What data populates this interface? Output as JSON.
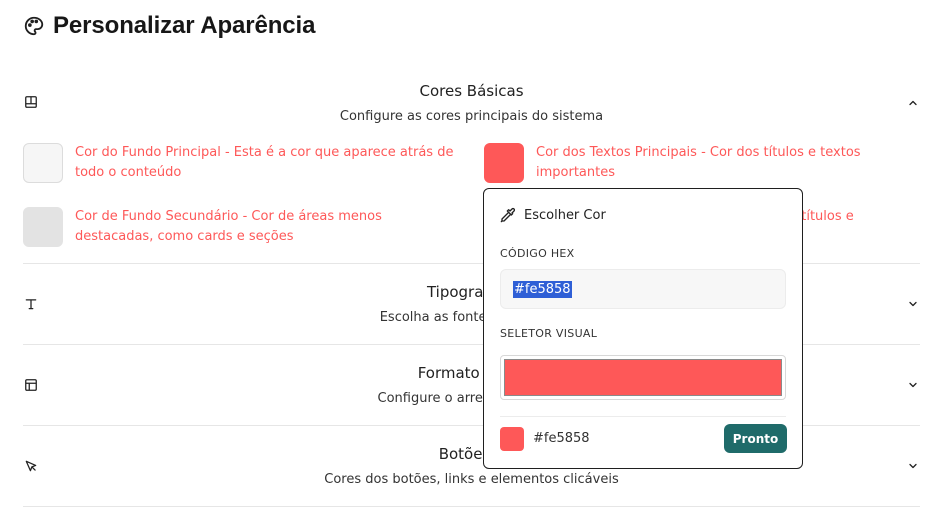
{
  "page": {
    "title": "Personalizar Aparência"
  },
  "sections": [
    {
      "title": "Cores Básicas",
      "subtitle": "Configure as cores principais do sistema",
      "expanded": true,
      "icon": "layout-panel-icon"
    },
    {
      "title": "Tipografia e",
      "subtitle": "Escolha as fontes que apare",
      "expanded": false,
      "icon": "type-icon"
    },
    {
      "title": "Formato e Esp",
      "subtitle": "Configure o arredondamento",
      "expanded": false,
      "icon": "layout-icon"
    },
    {
      "title": "Botões e",
      "subtitle": "Cores dos botões, links e elementos clicáveis",
      "expanded": false,
      "icon": "cursor-icon"
    }
  ],
  "colors": [
    {
      "label": "Cor do Fundo Principal - Esta é a cor que aparece atrás de todo o conteúdo",
      "value": "#f6f6f6"
    },
    {
      "label": "Cor dos Textos Principais - Cor dos títulos e textos importantes",
      "value": "#fe5858"
    },
    {
      "label": "Cor de Fundo Secundário - Cor de áreas menos destacadas, como cards e seções",
      "value": "#e3e3e3"
    },
    {
      "label": "btítulos e",
      "value": ""
    }
  ],
  "colors_text_color": "#fe5858",
  "picker": {
    "title": "Escolher Cor",
    "hex_label": "CÓDIGO HEX",
    "hex_value": "#fe5858",
    "visual_label": "SELETOR VISUAL",
    "current_color": "#fe5858",
    "footer_hex": "#fe5858",
    "done_label": "Pronto",
    "done_color": "#1f6b6a"
  }
}
